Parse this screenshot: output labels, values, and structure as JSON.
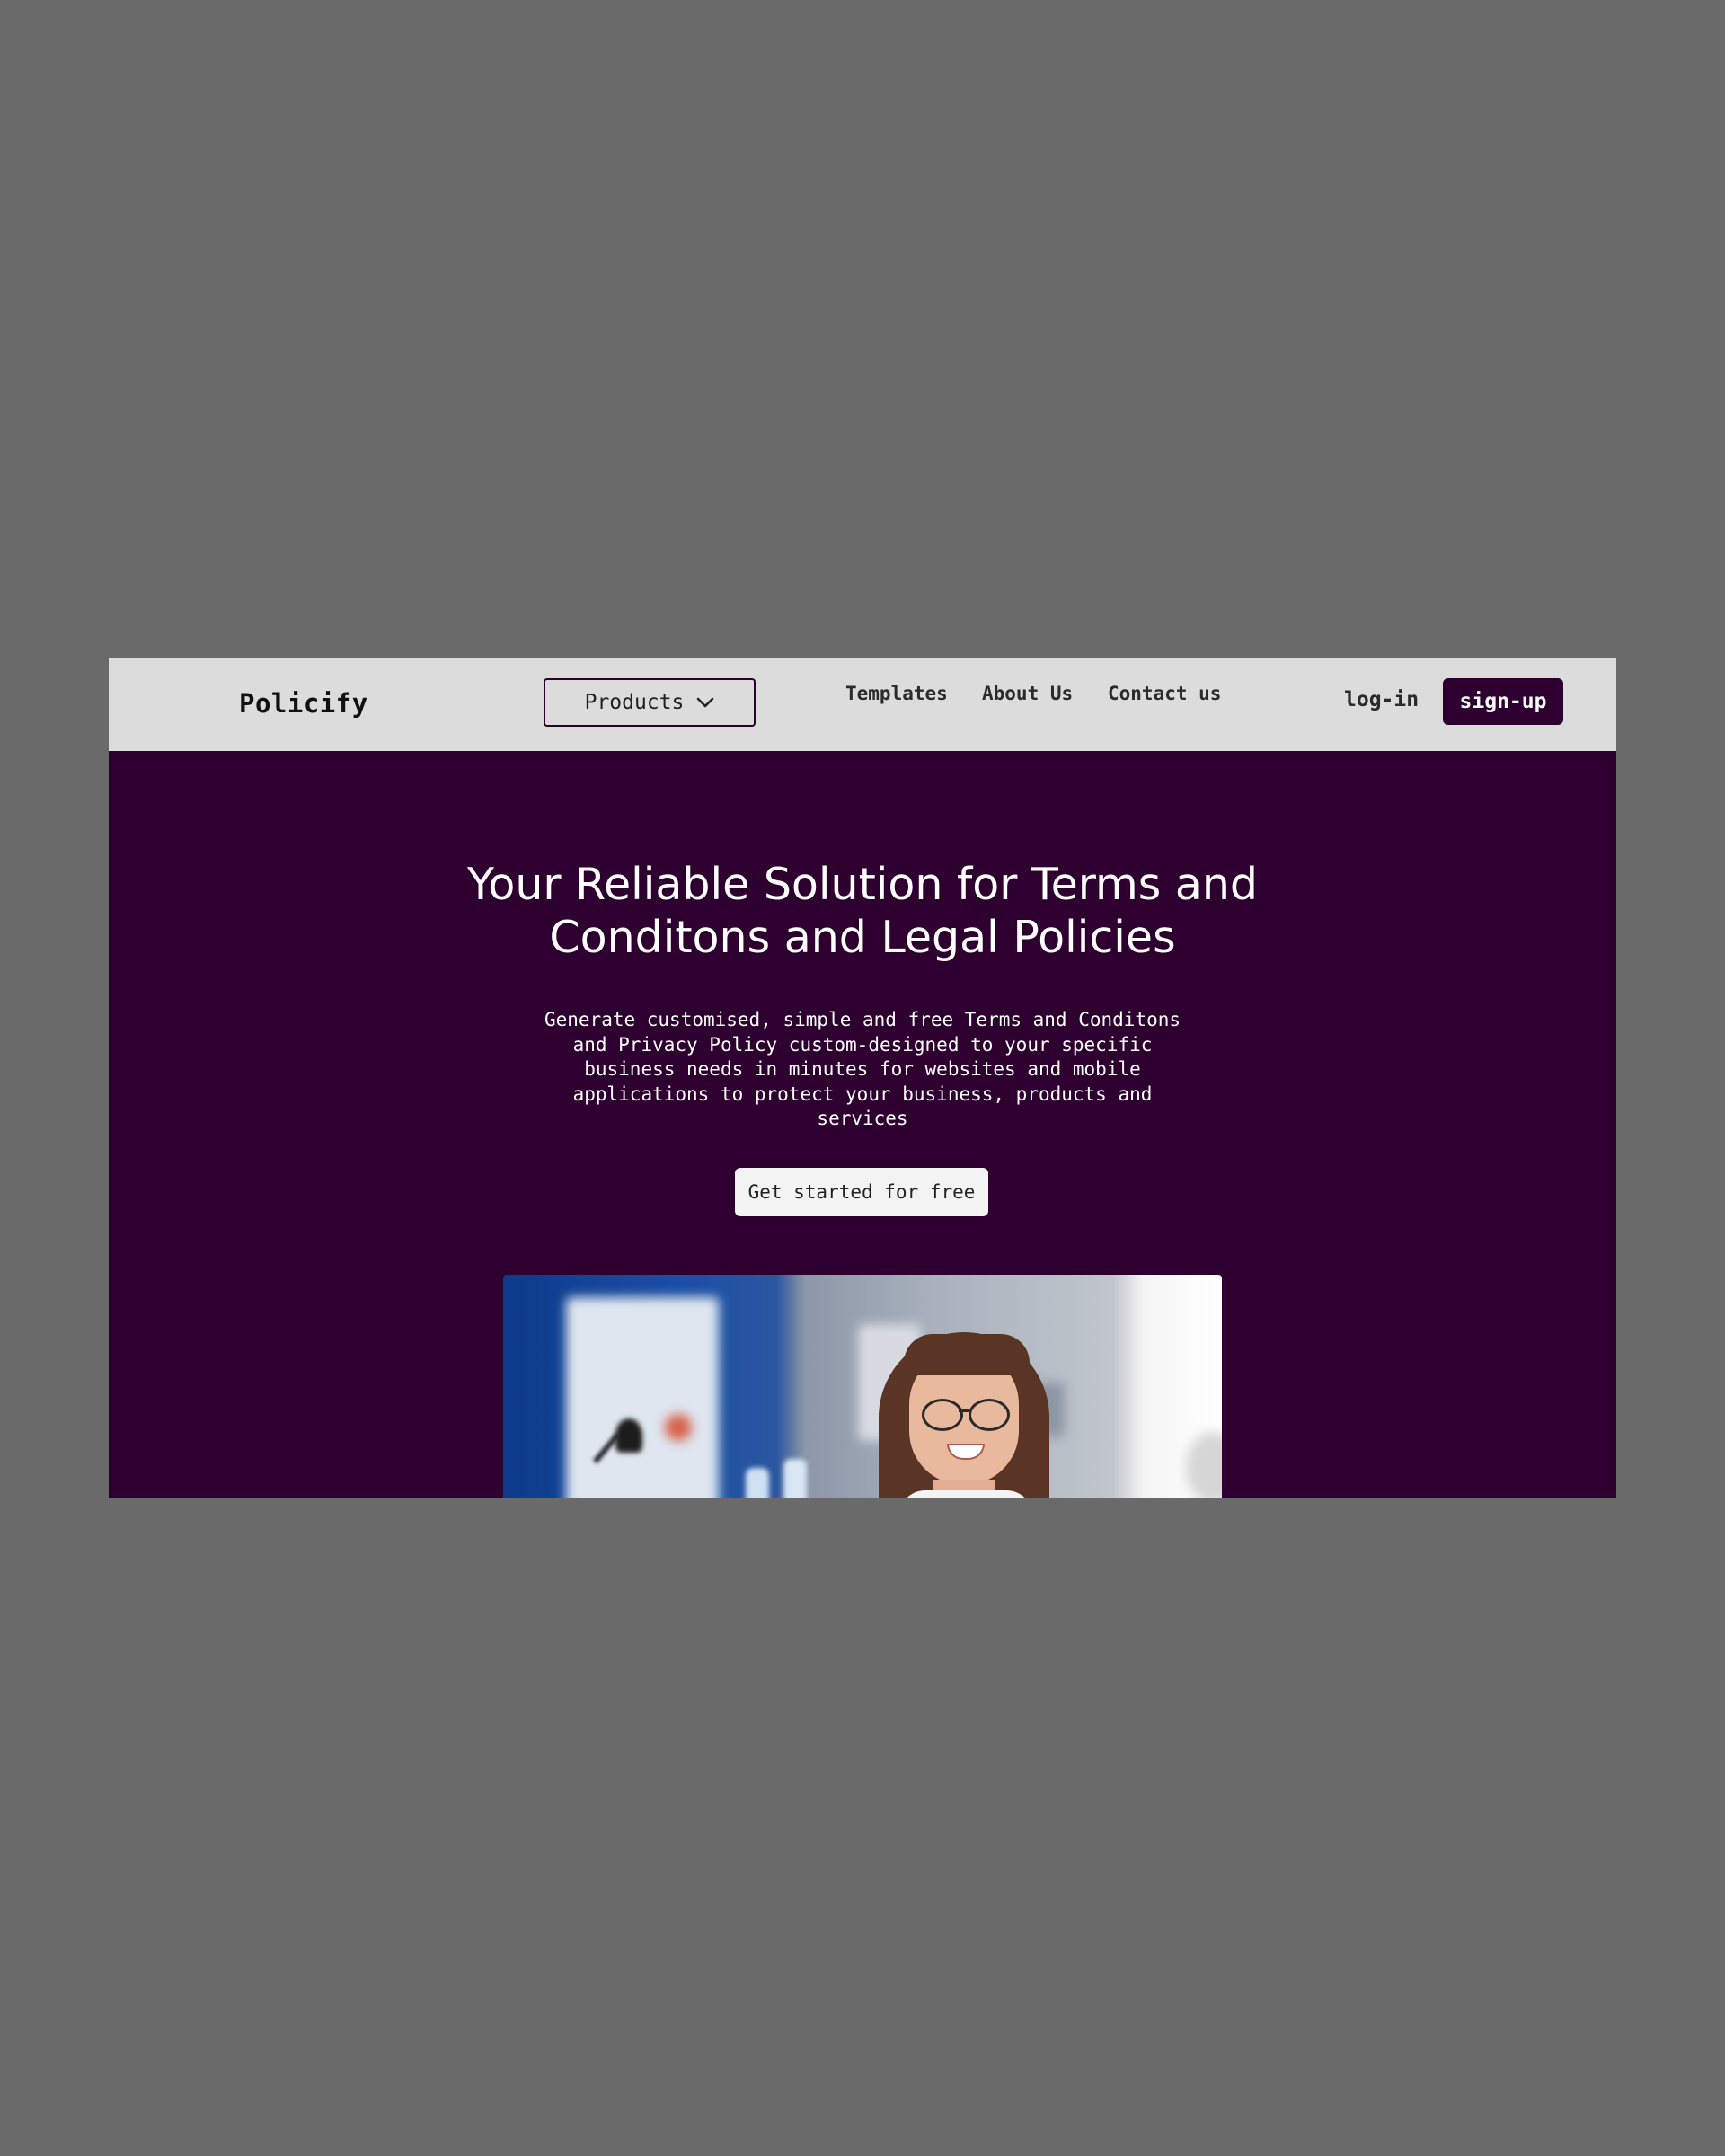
{
  "navbar": {
    "logo": "Policify",
    "products_label": "Products",
    "links": [
      "Templates",
      "About Us",
      "Contact us"
    ],
    "login_label": "log-in",
    "signup_label": "sign-up"
  },
  "hero": {
    "title_line1": "Your Reliable Solution for Terms and",
    "title_line2": "Conditons and Legal Policies",
    "subtitle_lines": [
      "Generate customised, simple and free Terms and Conditons",
      "and Privacy Policy custom-designed to your specific",
      "business needs in minutes for websites and mobile",
      "applications to protect your business, products and",
      "services"
    ],
    "cta_label": "Get started for free"
  },
  "colors": {
    "page_background": "#6a6a6a",
    "navbar_background": "#dcdcdc",
    "brand_purple": "#2d0030",
    "cta_background": "#f3f3f3"
  },
  "icons": {
    "products_dropdown": "chevron-down-icon"
  }
}
